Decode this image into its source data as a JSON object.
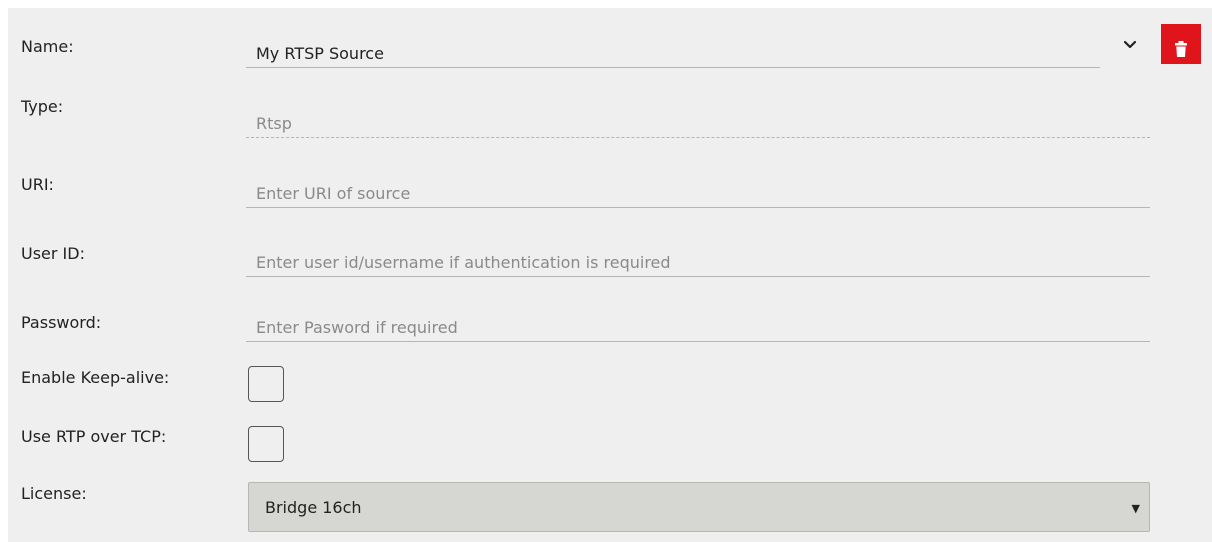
{
  "form": {
    "name": {
      "label": "Name:",
      "value": "My RTSP Source"
    },
    "type": {
      "label": "Type:",
      "value": "Rtsp"
    },
    "uri": {
      "label": "URI:",
      "placeholder": "Enter URI of source"
    },
    "user_id": {
      "label": "User ID:",
      "placeholder": "Enter user id/username if authentication is required"
    },
    "password": {
      "label": "Password:",
      "placeholder": "Enter Pasword if required"
    },
    "keep_alive": {
      "label": "Enable Keep-alive:",
      "checked": false
    },
    "rtp_over_tcp": {
      "label": "Use RTP over TCP:",
      "checked": false
    },
    "license": {
      "label": "License:",
      "selected": "Bridge 16ch"
    }
  },
  "icons": {
    "collapse": "chevron-down-icon",
    "delete": "trash-icon"
  },
  "colors": {
    "panel_background": "#efefef",
    "delete_button": "#e0141b",
    "select_background": "#d6d6d3"
  }
}
